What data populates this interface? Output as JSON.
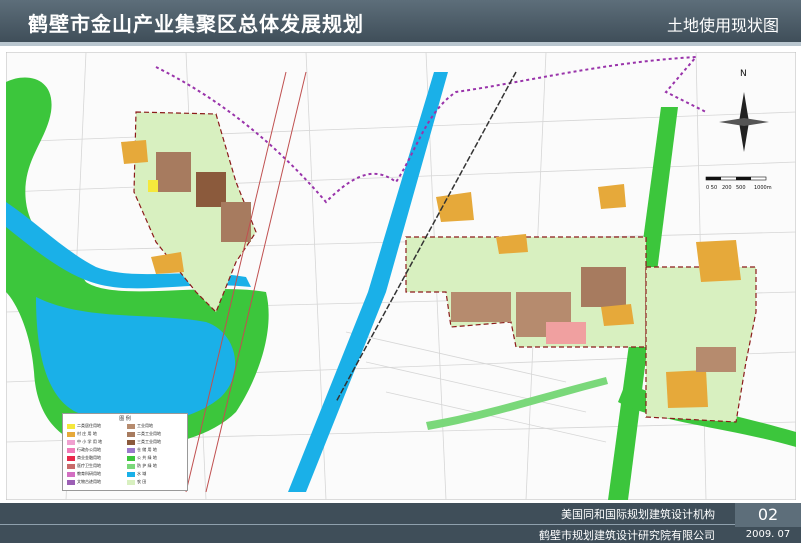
{
  "header": {
    "title": "鹤壁市金山产业集聚区总体发展规划",
    "subtitle": "土地使用现状图"
  },
  "map": {
    "north_label": "N",
    "scale_labels": [
      "0 50",
      "200",
      "500",
      "1000m"
    ],
    "legend_title": "图 例",
    "legend_items": [
      {
        "label": "二类居住用地",
        "color": "#f5e83c"
      },
      {
        "label": "村 庄 用 地",
        "color": "#e6a93a"
      },
      {
        "label": "中 小 学 用 地",
        "color": "#f0a0d0"
      },
      {
        "label": "行政办公用地",
        "color": "#f07ab8"
      },
      {
        "label": "商业金融用地",
        "color": "#e8284a"
      },
      {
        "label": "医疗卫生用地",
        "color": "#c86a6a"
      },
      {
        "label": "教育科研用地",
        "color": "#d36fc2"
      },
      {
        "label": "文物古迹用地",
        "color": "#9c5fb5"
      },
      {
        "label": "工业用地",
        "color": "#b68b6e"
      },
      {
        "label": "二类工业用地",
        "color": "#a77b5f"
      },
      {
        "label": "三类工业用地",
        "color": "#8b5a3c"
      },
      {
        "label": "仓 储 用 地",
        "color": "#9a7acc"
      },
      {
        "label": "公 共 绿 地",
        "color": "#3cc63c"
      },
      {
        "label": "防 护 绿 地",
        "color": "#7ad87a"
      },
      {
        "label": "水 域",
        "color": "#1ab0e8"
      },
      {
        "label": "农 田",
        "color": "#d8f0c0"
      }
    ],
    "colors": {
      "water": "#1ab0e8",
      "green": "#3cc63c",
      "farmland": "#d8f0c0",
      "village": "#e6a93a",
      "industry": "#b68b6e",
      "boundary": "#8b1a1a",
      "admin_boundary": "#9933aa"
    }
  },
  "footer": {
    "org1": "美国同和国际规划建筑设计机构",
    "org2": "鹤壁市规划建筑设计研究院有限公司",
    "page_no": "02",
    "date": "2009. 07"
  }
}
